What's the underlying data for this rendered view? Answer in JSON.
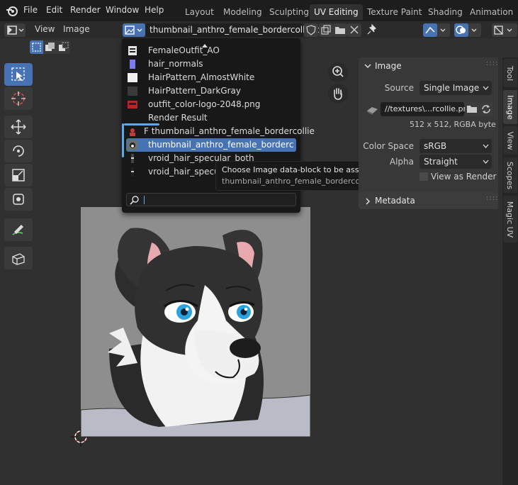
{
  "menubar": {
    "items": [
      "File",
      "Edit",
      "Render",
      "Window",
      "Help"
    ],
    "workspaces": [
      "Layout",
      "Modeling",
      "Sculpting",
      "UV Editing",
      "Texture Paint",
      "Shading",
      "Animation"
    ]
  },
  "header": {
    "view_label": "View",
    "image_label": "Image",
    "image_name": "thumbnail_anthro_female_bordercollie.png"
  },
  "dropdown": {
    "items": [
      {
        "label": "FemaleOutfit_AO",
        "icon": "image-icon",
        "color": "#e6e6e6"
      },
      {
        "label": "hair_normals",
        "icon": "image-icon",
        "color": "#7c7cf0"
      },
      {
        "label": "HairPattern_AlmostWhite",
        "icon": "image-icon",
        "color": "#f0f0f0"
      },
      {
        "label": "HairPattern_DarkGray",
        "icon": "image-icon",
        "color": "#3a3a3a"
      },
      {
        "label": "outfit_color-logo-2048.png",
        "icon": "image-icon",
        "color": "#b02a2a"
      },
      {
        "label": "Render Result",
        "icon": "render-icon",
        "color": "#181818"
      },
      {
        "label": "F thumbnail_anthro_female_bordercollie",
        "icon": "image-icon",
        "color": "#c23a3a"
      },
      {
        "label": "thumbnail_anthro_female_bordercollie.pn",
        "icon": "image-icon",
        "color": "#6f6f6f"
      },
      {
        "label": "vroid_hair_specular_both",
        "icon": "image-icon",
        "color": "#444444"
      },
      {
        "label": "vroid_hair_specular",
        "icon": "image-icon",
        "color": "#222222"
      }
    ],
    "search_placeholder": ""
  },
  "tooltip": {
    "line1": "Choose Image data-block to be assigned to this user",
    "line2": "thumbnail_anthro_female_bordercollie.png"
  },
  "npanel": {
    "image_title": "Image",
    "source_label": "Source",
    "source_value": "Single Image",
    "filepath": "//textures\\...rcollie.png",
    "info": "512 x 512,  RGBA byte",
    "colorspace_label": "Color Space",
    "colorspace_value": "sRGB",
    "alpha_label": "Alpha",
    "alpha_value": "Straight",
    "view_as_render": "View as Render",
    "metadata_title": "Metadata"
  },
  "sidetabs": [
    "Tool",
    "Image",
    "View",
    "Scopes",
    "Magic UV"
  ],
  "colors": {
    "accent": "#4772b3",
    "background": "#303030",
    "menubar": "#1d1d1d"
  }
}
